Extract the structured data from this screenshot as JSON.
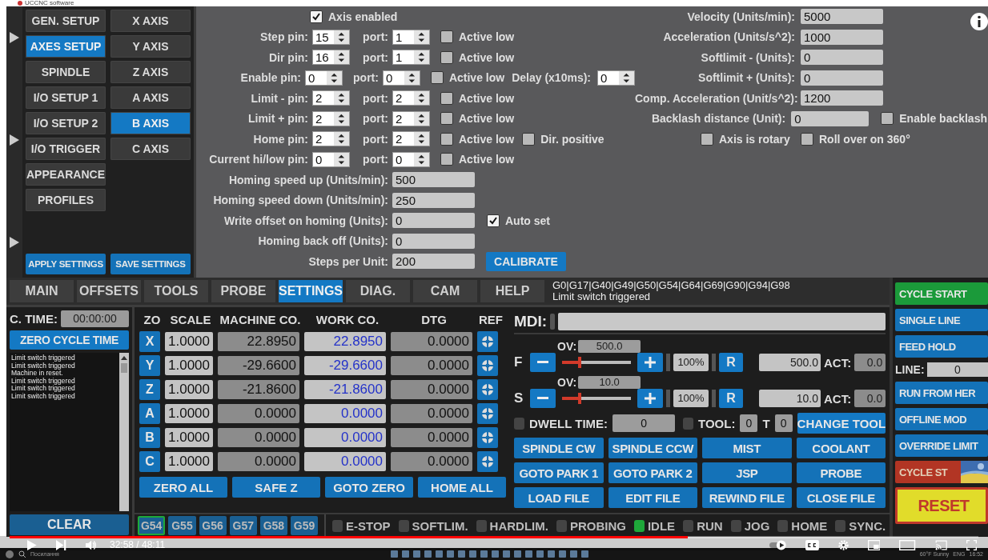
{
  "window": {
    "title": "UCCNC software"
  },
  "setup_menu": [
    {
      "label": "GEN. SETUP",
      "selected": false
    },
    {
      "label": "AXES SETUP",
      "selected": true
    },
    {
      "label": "SPINDLE",
      "selected": false
    },
    {
      "label": "I/O SETUP 1",
      "selected": false
    },
    {
      "label": "I/O SETUP 2",
      "selected": false
    },
    {
      "label": "I/O TRIGGER",
      "selected": false
    },
    {
      "label": "APPEARANCE",
      "selected": false
    },
    {
      "label": "PROFILES",
      "selected": false
    }
  ],
  "axis_menu": [
    {
      "label": "X AXIS",
      "selected": false
    },
    {
      "label": "Y AXIS",
      "selected": false
    },
    {
      "label": "Z AXIS",
      "selected": false
    },
    {
      "label": "A AXIS",
      "selected": false
    },
    {
      "label": "B AXIS",
      "selected": true
    },
    {
      "label": "C AXIS",
      "selected": false
    }
  ],
  "settings_actions": [
    "APPLY SETTINGS",
    "SAVE SETTINGS"
  ],
  "axis_enabled": {
    "label": "Axis enabled",
    "checked": true
  },
  "pins": [
    {
      "label": "Step pin:",
      "pin": "15",
      "port_label": "port:",
      "port": "1",
      "active_low_label": "Active low",
      "active_low": false
    },
    {
      "label": "Dir pin:",
      "pin": "16",
      "port_label": "port:",
      "port": "1",
      "active_low_label": "Active low",
      "active_low": false
    },
    {
      "label": "Enable pin:",
      "pin": "0",
      "port_label": "port:",
      "port": "0",
      "active_low_label": "Active low",
      "active_low": false,
      "extra": {
        "kind": "delay",
        "label": "Delay (x10ms):",
        "value": "0"
      }
    },
    {
      "label": "Limit - pin:",
      "pin": "2",
      "port_label": "port:",
      "port": "2",
      "active_low_label": "Active low",
      "active_low": false
    },
    {
      "label": "Limit + pin:",
      "pin": "2",
      "port_label": "port:",
      "port": "2",
      "active_low_label": "Active low",
      "active_low": false
    },
    {
      "label": "Home pin:",
      "pin": "2",
      "port_label": "port:",
      "port": "2",
      "active_low_label": "Active low",
      "active_low": false,
      "extra": {
        "kind": "check",
        "label": "Dir. positive",
        "checked": false
      }
    },
    {
      "label": "Current hi/low pin:",
      "pin": "0",
      "port_label": "port:",
      "port": "0",
      "active_low_label": "Active low",
      "active_low": false
    }
  ],
  "homing_fields": [
    {
      "label": "Homing speed up (Units/min):",
      "value": "500"
    },
    {
      "label": "Homing speed down (Units/min):",
      "value": "250"
    },
    {
      "label": "Write offset on homing (Units):",
      "value": "0",
      "extra": {
        "kind": "check",
        "label": "Auto set",
        "checked": true
      }
    },
    {
      "label": "Homing back off (Units):",
      "value": "0"
    },
    {
      "label": "Steps per Unit:",
      "value": "200",
      "extra": {
        "kind": "button",
        "label": "CALIBRATE"
      }
    }
  ],
  "motion_fields": [
    {
      "label": "Velocity (Units/min):",
      "value": "5000"
    },
    {
      "label": "Acceleration (Units/s^2):",
      "value": "1000"
    },
    {
      "label": "Softlimit - (Units):",
      "value": "0"
    },
    {
      "label": "Softlimit + (Units):",
      "value": "0"
    },
    {
      "label": "Comp. Acceleration (Unit/s^2):",
      "value": "1200"
    },
    {
      "label": "Backlash distance (Unit):",
      "value": "0",
      "extra": {
        "kind": "check",
        "label": "Enable backlash",
        "checked": false
      }
    }
  ],
  "rotary_options": [
    {
      "label": "Axis is rotary",
      "checked": false
    },
    {
      "label": "Roll over on 360°",
      "checked": false
    }
  ],
  "main_tabs": [
    {
      "label": "MAIN",
      "selected": false
    },
    {
      "label": "OFFSETS",
      "selected": false
    },
    {
      "label": "TOOLS",
      "selected": false
    },
    {
      "label": "PROBE",
      "selected": false
    },
    {
      "label": "SETTINGS",
      "selected": true
    },
    {
      "label": "DIAG.",
      "selected": false
    },
    {
      "label": "CAM",
      "selected": false
    },
    {
      "label": "HELP",
      "selected": false
    }
  ],
  "status": {
    "modal": "G0|G17|G40|G49|G50|G54|G64|G69|G90|G94|G98",
    "message": "Limit switch triggered"
  },
  "cycle_time": {
    "label": "C. TIME:",
    "value": "00:00:00"
  },
  "zero_cycle_time": "ZERO CYCLE TIME",
  "log": [
    "Limit switch triggered",
    "Limit switch triggered",
    "Machine in reset.",
    "Limit switch triggered",
    "Limit switch triggered",
    "Limit switch triggered"
  ],
  "clear": "CLEAR",
  "axes_table": {
    "columns": [
      "ZO",
      "SCALE",
      "MACHINE CO.",
      "WORK CO.",
      "DTG",
      "REF"
    ],
    "rows": [
      {
        "axis": "X",
        "scale": "1.0000",
        "machine": "22.8950",
        "work": "22.8950",
        "dtg": "0.0000"
      },
      {
        "axis": "Y",
        "scale": "1.0000",
        "machine": "-29.6600",
        "work": "-29.6600",
        "dtg": "0.0000"
      },
      {
        "axis": "Z",
        "scale": "1.0000",
        "machine": "-21.8600",
        "work": "-21.8600",
        "dtg": "0.0000"
      },
      {
        "axis": "A",
        "scale": "1.0000",
        "machine": "0.0000",
        "work": "0.0000",
        "dtg": "0.0000"
      },
      {
        "axis": "B",
        "scale": "1.0000",
        "machine": "0.0000",
        "work": "0.0000",
        "dtg": "0.0000"
      },
      {
        "axis": "C",
        "scale": "1.0000",
        "machine": "0.0000",
        "work": "0.0000",
        "dtg": "0.0000"
      }
    ]
  },
  "axis_actions": [
    "ZERO ALL",
    "SAFE Z",
    "GOTO ZERO",
    "HOME ALL"
  ],
  "work_offsets": [
    {
      "label": "G54",
      "selected": true
    },
    {
      "label": "G55",
      "selected": false
    },
    {
      "label": "G56",
      "selected": false
    },
    {
      "label": "G57",
      "selected": false
    },
    {
      "label": "G58",
      "selected": false
    },
    {
      "label": "G59",
      "selected": false
    }
  ],
  "mdi": {
    "label": "MDI:"
  },
  "overrides": [
    {
      "label": "F",
      "ov_label": "OV:",
      "ov_value": "500.0",
      "level": 0.25,
      "percent": "100%",
      "reset": "R",
      "set_value": "500.0",
      "act_label": "ACT:",
      "act_value": "0.0"
    },
    {
      "label": "S",
      "ov_label": "OV:",
      "ov_value": "10.0",
      "level": 0.25,
      "percent": "100%",
      "reset": "R",
      "set_value": "10.0",
      "act_label": "ACT:",
      "act_value": "0.0"
    }
  ],
  "dwell": {
    "label": "DWELL TIME:",
    "value": "0",
    "checked": false
  },
  "tool": {
    "label": "TOOL:",
    "value": "0",
    "t_label": "T",
    "t_value": "0",
    "checked": false
  },
  "change_tool": "CHANGE TOOL",
  "mdi_buttons": [
    "SPINDLE CW",
    "SPINDLE CCW",
    "MIST",
    "COOLANT",
    "GOTO PARK 1",
    "GOTO PARK 2",
    "JSP",
    "PROBE",
    "LOAD FILE",
    "EDIT FILE",
    "REWIND FILE",
    "CLOSE FILE"
  ],
  "leds": [
    {
      "label": "E-STOP",
      "on": false
    },
    {
      "label": "SOFTLIM.",
      "on": false
    },
    {
      "label": "HARDLIM.",
      "on": false
    },
    {
      "label": "PROBING",
      "on": false
    },
    {
      "label": "IDLE",
      "on": true
    },
    {
      "label": "RUN",
      "on": false
    },
    {
      "label": "JOG",
      "on": false
    },
    {
      "label": "HOME",
      "on": false
    },
    {
      "label": "SYNC.",
      "on": false
    }
  ],
  "control_buttons": [
    {
      "kind": "start",
      "label": "CYCLE START"
    },
    {
      "kind": "normal",
      "label": "SINGLE LINE"
    },
    {
      "kind": "normal",
      "label": "FEED HOLD"
    },
    {
      "kind": "line",
      "label": "LINE:",
      "value": "0"
    },
    {
      "kind": "normal",
      "label": "RUN FROM HER"
    },
    {
      "kind": "normal",
      "label": "OFFLINE MOD"
    },
    {
      "kind": "normal",
      "label": "OVERRIDE LIMIT"
    },
    {
      "kind": "stop",
      "label": "CYCLE ST"
    },
    {
      "kind": "reset",
      "label": "RESET"
    }
  ],
  "player": {
    "time": "32:58 / 48:11",
    "level": 0.7
  },
  "taskbar": {
    "search": "Посилання",
    "weather": "60°F Sunny",
    "language": "ENG",
    "clock": "16:52"
  }
}
